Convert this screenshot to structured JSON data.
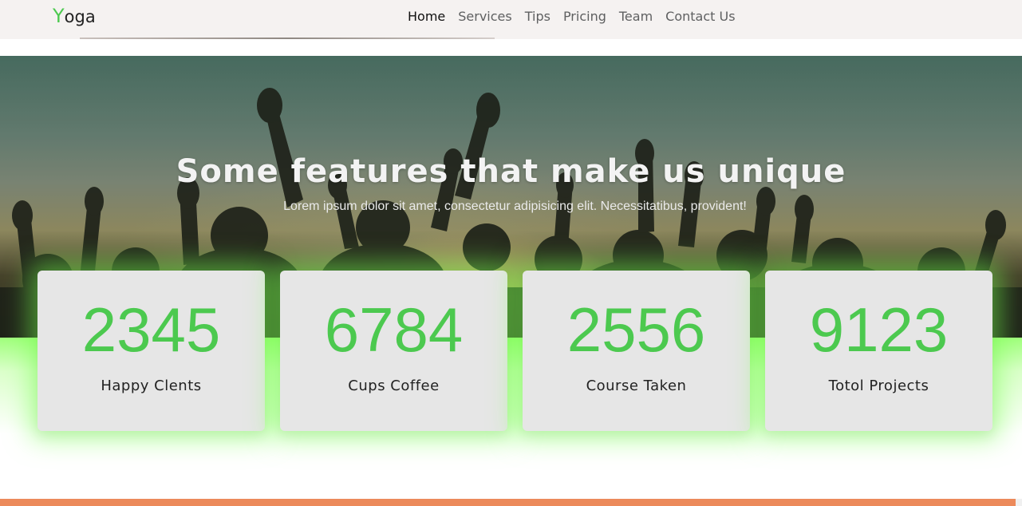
{
  "brand": {
    "first_letter": "Y",
    "rest": "oga"
  },
  "nav": {
    "items": [
      "Home",
      "Services",
      "Tips",
      "Pricing",
      "Team",
      "Contact Us"
    ],
    "active": "Home"
  },
  "hero": {
    "title": "Some features that make us unique",
    "subtitle": "Lorem ipsum dolor sit amet, consectetur adipisicing elit. Necessitatibus, provident!"
  },
  "stats": [
    {
      "value": "2345",
      "label": "Happy Clents"
    },
    {
      "value": "6784",
      "label": "Cups Coffee"
    },
    {
      "value": "2556",
      "label": "Course Taken"
    },
    {
      "value": "9123",
      "label": "Totol Projects"
    }
  ],
  "colors": {
    "accent_green": "#4cc94f",
    "navbar_bg": "#f5f2f1",
    "card_bg": "#e6e6e6",
    "footer_bar": "#ec8a5b"
  }
}
